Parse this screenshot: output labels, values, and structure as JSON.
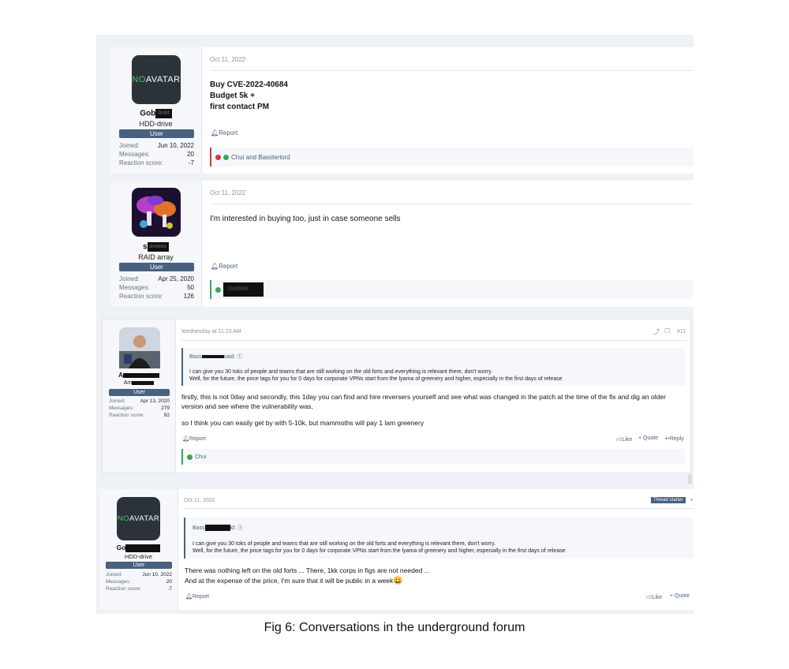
{
  "posts": [
    {
      "avatar_text_a": "NO ",
      "avatar_text_b": "AVATAR",
      "username": "Gob",
      "username_redacted": "linlit",
      "user_title": "HDD-drive",
      "badge": "User",
      "joined_label": "Joined:",
      "joined": "Jun 10, 2022",
      "messages_label": "Messages:",
      "messages": "20",
      "reaction_label": "Reaction score:",
      "reaction": "-7",
      "date": "Oct 11, 2022",
      "line1": "Buy CVE-2022-40684",
      "line2": "Budget 5k +",
      "line3": "first contact PM",
      "report": "Report",
      "reactions": "Chui and Bassterlord"
    },
    {
      "username": "s",
      "username_redacted": "anwax",
      "user_title": "RAID array",
      "badge": "User",
      "joined_label": "Joined:",
      "joined": "Apr 25, 2020",
      "messages_label": "Messages:",
      "messages": "50",
      "reaction_label": "Reaction score:",
      "reaction": "126",
      "date": "Oct 11, 2022",
      "text": "I'm interested in buying too, just in case someone sells",
      "report": "Report",
      "reactions": "Goblinlit"
    },
    {
      "username": "A",
      "username_redacted": "",
      "user_title": "Am",
      "badge": "User",
      "joined_label": "Joined:",
      "joined": "Apr 13, 2020",
      "messages_label": "Messages:",
      "messages": "279",
      "reaction_label": "Reaction score:",
      "reaction": "92",
      "date": "Wednesday at 11:23 AM",
      "post_number": "#11",
      "quote_author_a": "Bass",
      "quote_author_b": "said:",
      "quote_line1": "I can give you 30 toks of people and teams that are still working on the old forts and everything is relevant there, don't worry.",
      "quote_line2": "Well, for the future, the price tags for you for 0 days for corporate VPNs start from the lyama of greenery and higher, especially in the first days of release",
      "text1": "firstly, this is not 0day and secondly, this 1day you can find and hire reversers yourself and see what was changed in the patch at the time of the fix and dig an older version and see where the vulnerability was,",
      "text2": "so I think you can easily get by with 5-10k, but mammoths will pay 1 lam greenery",
      "report": "Report",
      "like": "Like",
      "quote": "+ Quote",
      "reply": "Reply",
      "reactions": "Chui"
    },
    {
      "avatar_text_a": "NO ",
      "avatar_text_b": "AVATAR",
      "username": "Go",
      "username_redacted": "",
      "user_title": "HDD-drive",
      "badge": "User",
      "joined_label": "Joined:",
      "joined": "Jun 10, 2022",
      "messages_label": "Messages:",
      "messages": "20",
      "reaction_label": "Reaction score:",
      "reaction": "-7",
      "date": "Oct 11, 2022",
      "thread_starter": "Thread starter",
      "quote_author_a": "Bass",
      "quote_author_b": "id:",
      "quote_line1": "I can give you 30 toks of people and teams that are still working on the old forts and everything is relevant there, don't worry.",
      "quote_line2": "Well, for the future, the price tags for you for 0 days for corporate VPNs start from the lyama of greenery and higher, especially in the first days of release",
      "text1": "There was nothing left on the old forts ... There, 1kk corps in figs are not needed ...",
      "text2": "And at the expense of the price, I'm sure that it will be public in a week",
      "emoji": "😀",
      "report": "Report",
      "like": "Like",
      "quote": "+ Quote"
    }
  ],
  "caption": "Fig 6: Conversations in the underground forum",
  "colors": {
    "accent": "#47617f",
    "badge": "#47617f",
    "green": "#4ec26e",
    "red": "#d13a3a"
  }
}
